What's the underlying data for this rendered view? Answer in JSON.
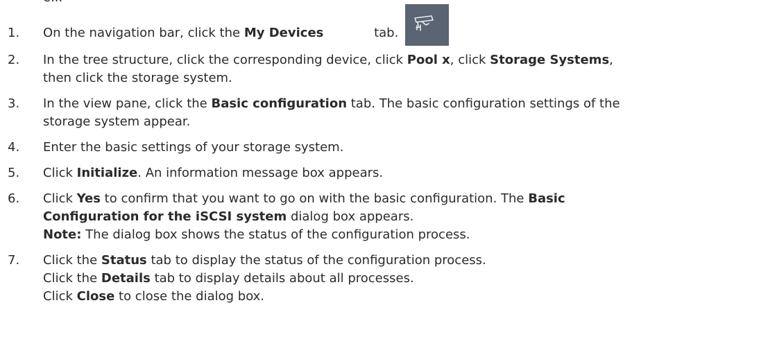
{
  "clipped_heading": "e...",
  "steps": [
    {
      "number": "1.",
      "lines": [
        [
          {
            "t": "On the navigation bar, click the "
          },
          {
            "b": "My Devices"
          },
          {
            "icon": "my-devices"
          },
          {
            "t": " tab."
          }
        ]
      ]
    },
    {
      "number": "2.",
      "lines": [
        [
          {
            "t": "In the tree structure, click the corresponding device, click "
          },
          {
            "b": "Pool x"
          },
          {
            "t": ", click "
          },
          {
            "b": "Storage Systems"
          },
          {
            "t": ","
          }
        ],
        [
          {
            "t": "then click the storage system."
          }
        ]
      ]
    },
    {
      "number": "3.",
      "lines": [
        [
          {
            "t": "In the view pane, click the "
          },
          {
            "b": "Basic configuration"
          },
          {
            "t": " tab. The basic configuration settings of the"
          }
        ],
        [
          {
            "t": "storage system appear."
          }
        ]
      ]
    },
    {
      "number": "4.",
      "lines": [
        [
          {
            "t": "Enter the basic settings of your storage system."
          }
        ]
      ]
    },
    {
      "number": "5.",
      "lines": [
        [
          {
            "t": "Click "
          },
          {
            "b": "Initialize"
          },
          {
            "t": ". An information message box appears."
          }
        ]
      ]
    },
    {
      "number": "6.",
      "lines": [
        [
          {
            "t": "Click "
          },
          {
            "b": "Yes"
          },
          {
            "t": " to confirm that you want to go on with the basic configuration. The "
          },
          {
            "b": "Basic"
          }
        ],
        [
          {
            "b": "Configuration for the iSCSI system"
          },
          {
            "t": " dialog box appears."
          }
        ],
        [
          {
            "b": "Note:"
          },
          {
            "t": " The dialog box shows the status of the configuration process."
          }
        ]
      ]
    },
    {
      "number": "7.",
      "lines": [
        [
          {
            "t": "Click the "
          },
          {
            "b": "Status"
          },
          {
            "t": " tab to display the status of the configuration process."
          }
        ],
        [
          {
            "t": "Click the "
          },
          {
            "b": "Details"
          },
          {
            "t": " tab to display details about all processes."
          }
        ],
        [
          {
            "t": "Click "
          },
          {
            "b": "Close"
          },
          {
            "t": " to close the dialog box."
          }
        ]
      ]
    }
  ],
  "icons": {
    "my-devices": {
      "name": "my-devices-camera-icon",
      "background": "#5a6472",
      "stroke": "#e8ecf0"
    }
  }
}
